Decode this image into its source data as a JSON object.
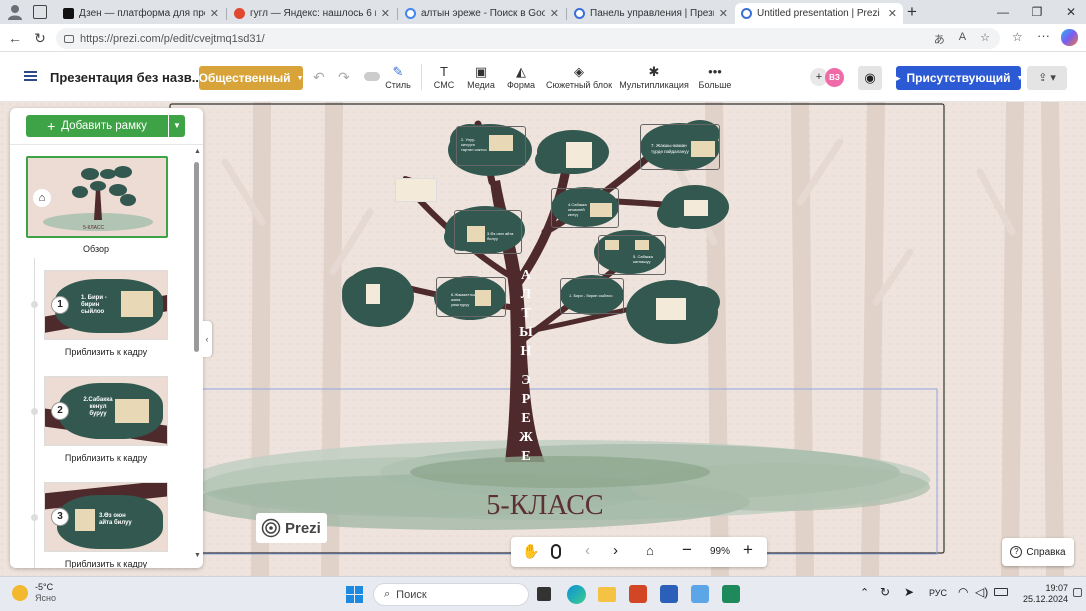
{
  "browser": {
    "tabs": [
      {
        "title": "Дзен — платформа для просмот",
        "color": "#111111"
      },
      {
        "title": "гугл — Яндекс: нашлось 6 млн р",
        "color": "#e0492f"
      },
      {
        "title": "алтын эреже - Поиск в Google",
        "color": "#4285f4"
      },
      {
        "title": "Панель управления | Прези",
        "color": "#3b6fd8"
      },
      {
        "title": "Untitled presentation | Prezi",
        "color": "#3b6fd8"
      }
    ],
    "url": "https://prezi.com/p/edit/cvejtmq1sd31/"
  },
  "toolbar": {
    "title": "Презентация без назв...",
    "visibility": "Общественный",
    "tools": [
      "Стиль",
      "СМС",
      "Медиа",
      "Форма",
      "Сюжетный блок",
      "Мультипликация",
      "Больше"
    ],
    "avatar": "ВЗ",
    "present": "Присутствующий"
  },
  "sidebar": {
    "add_frame": "Добавить рамку",
    "overview_label": "Обзор",
    "frames": [
      {
        "num": "1",
        "text": "1. Бири - бирин сыйлоо",
        "label": "Приблизить к кадру"
      },
      {
        "num": "2",
        "text": "2.Сабакка кенул буруу",
        "label": "Приблизить к кадру"
      },
      {
        "num": "3",
        "text": "3.Өз оюн айта билуу",
        "label": "Приблизить к кадру"
      }
    ],
    "overview_thumb_text": "5-КЛАСС"
  },
  "canvas": {
    "trunk_text": [
      "А",
      "Л",
      "Т",
      "Ы",
      "Н",
      "",
      "Э",
      "Р",
      "Е",
      "Ж",
      "Е"
    ],
    "class_label": "5-КЛАСС",
    "prezi_logo": "Prezi",
    "nodes": [
      "2. Улуу-кичүүгө тартип сактоо",
      "7. Жакшы-жаман турдө пайдалануу",
      "4.Сабакка кечикпей келүү",
      "3.Өз оюн айта билуу",
      "5. Сабакка катнашуу",
      "6.Жамааттык жана уюштуруу",
      "1. Бири - бирин сыйлоо"
    ]
  },
  "zoom": {
    "level": "99%"
  },
  "help": "Справка",
  "taskbar": {
    "temp": "-5°C",
    "weather": "Ясно",
    "search": "Поиск",
    "lang": "РУС",
    "time": "19:07",
    "date": "25.12.2024"
  }
}
